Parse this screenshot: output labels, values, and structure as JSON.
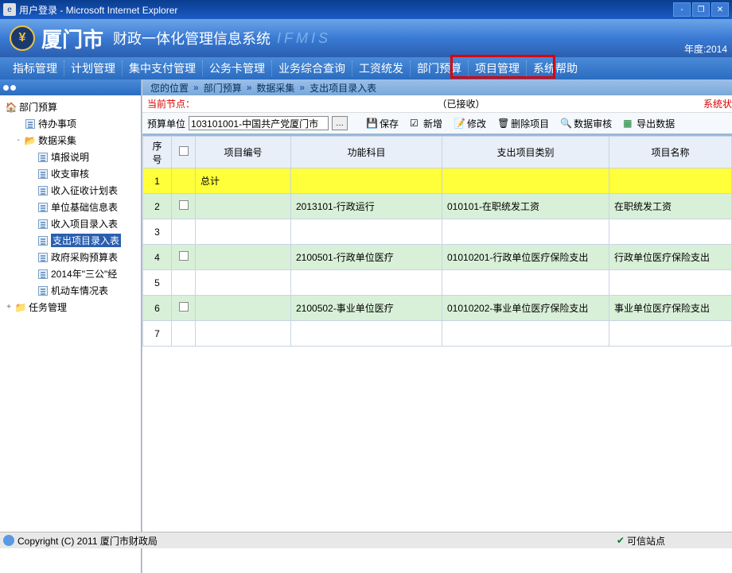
{
  "window": {
    "title": "用户登录 - Microsoft Internet Explorer"
  },
  "header": {
    "city": "厦门市",
    "system": "财政一体化管理信息系统",
    "system_en": "IFMIS",
    "year_label": "年度:2014"
  },
  "menu": {
    "items": [
      "指标管理",
      "计划管理",
      "集中支付管理",
      "公务卡管理",
      "业务综合查询",
      "工资统发",
      "部门预算",
      "项目管理",
      "系统帮助"
    ]
  },
  "sidebar": {
    "root": "部门预算",
    "items": [
      {
        "label": "待办事项",
        "level": 1,
        "icon": "page"
      },
      {
        "label": "数据采集",
        "level": 1,
        "icon": "folder-open",
        "toggle": "-"
      },
      {
        "label": "填报说明",
        "level": 2,
        "icon": "page"
      },
      {
        "label": "收支审核",
        "level": 2,
        "icon": "page"
      },
      {
        "label": "收入征收计划表",
        "level": 2,
        "icon": "page"
      },
      {
        "label": "单位基础信息表",
        "level": 2,
        "icon": "page"
      },
      {
        "label": "收入项目录入表",
        "level": 2,
        "icon": "page"
      },
      {
        "label": "支出项目录入表",
        "level": 2,
        "icon": "page",
        "selected": true
      },
      {
        "label": "政府采购预算表",
        "level": 2,
        "icon": "page"
      },
      {
        "label": "2014年\"三公\"经",
        "level": 2,
        "icon": "page"
      },
      {
        "label": "机动车情况表",
        "level": 2,
        "icon": "page"
      },
      {
        "label": "任务管理",
        "level": 0,
        "icon": "folder",
        "toggle": "+"
      }
    ]
  },
  "breadcrumb": {
    "label": "您的位置",
    "items": [
      "部门预算",
      "数据采集",
      "支出项目录入表"
    ]
  },
  "status_line": {
    "current_label": "当前节点：",
    "received": "（已接收）",
    "sys_status": "系统状"
  },
  "toolbar": {
    "unit_label": "预算单位",
    "unit_value": "103101001-中国共产党厦门市",
    "buttons": {
      "save": "保存",
      "add": "新增",
      "edit": "修改",
      "delete": "删除项目",
      "audit": "数据审核",
      "export": "导出数据"
    }
  },
  "table": {
    "headers": [
      "序号",
      "",
      "项目编号",
      "功能科目",
      "支出项目类别",
      "项目名称"
    ],
    "rows": [
      {
        "no": "1",
        "code": "总计",
        "func": "",
        "cat": "",
        "name": "",
        "total": true,
        "chk": false
      },
      {
        "no": "2",
        "code": "",
        "func": "2013101-行政运行",
        "cat": "010101-在职统发工资",
        "name": "在职统发工资",
        "even": true,
        "chk": true
      },
      {
        "no": "3",
        "code": "",
        "func": "",
        "cat": "",
        "name": "",
        "chk": false
      },
      {
        "no": "4",
        "code": "",
        "func": "2100501-行政单位医疗",
        "cat": "01010201-行政单位医疗保险支出",
        "name": "行政单位医疗保险支出",
        "even": true,
        "chk": true
      },
      {
        "no": "5",
        "code": "",
        "func": "",
        "cat": "",
        "name": "",
        "chk": false
      },
      {
        "no": "6",
        "code": "",
        "func": "2100502-事业单位医疗",
        "cat": "01010202-事业单位医疗保险支出",
        "name": "事业单位医疗保险支出",
        "even": true,
        "chk": true
      },
      {
        "no": "7",
        "code": "",
        "func": "",
        "cat": "",
        "name": "",
        "chk": false
      }
    ]
  },
  "statusbar": {
    "copyright": "Copyright (C) 2011 厦门市财政局",
    "trust": "可信站点"
  }
}
